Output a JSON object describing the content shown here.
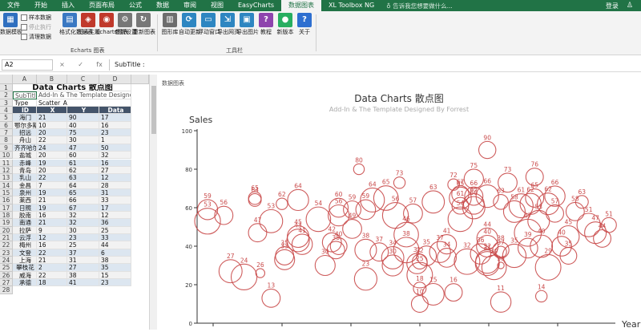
{
  "ribbon_tabs": [
    "文件",
    "开始",
    "插入",
    "页面布局",
    "公式",
    "数据",
    "审阅",
    "视图",
    "EasyCharts",
    "数据图表",
    "XL Toolbox NG"
  ],
  "active_tab": "数据图表",
  "tell_me": "告诉我您想要做什么...",
  "login": "登录",
  "share": "♙",
  "ribbon": {
    "left_buttons": [
      {
        "id": "data-template",
        "label": "数据模板",
        "color": "#2f6fbf",
        "glyph": "▦"
      }
    ],
    "small_buttons": [
      {
        "id": "sample-data",
        "label": "样本数据",
        "disabled": false
      },
      {
        "id": "stop-exec",
        "label": "停止执行",
        "disabled": true
      },
      {
        "id": "clear-data",
        "label": "清理数据",
        "disabled": false
      }
    ],
    "group1_buttons": [
      {
        "id": "format-data",
        "label": "格式化数据表",
        "color": "#3a78c2",
        "glyph": "▤"
      },
      {
        "id": "chart-theme",
        "label": "图表主题",
        "color": "#c0392b",
        "glyph": "◈"
      },
      {
        "id": "echarts-chart",
        "label": "Echarts图表",
        "color": "#c0392b",
        "glyph": "◉"
      },
      {
        "id": "param-settings",
        "label": "参数设置",
        "color": "#777777",
        "glyph": "⚙"
      },
      {
        "id": "redraw-chart",
        "label": "重新图表",
        "color": "#777777",
        "glyph": "↻"
      }
    ],
    "group1_label": "Echarts 图表",
    "group2_buttons": [
      {
        "id": "chart-library",
        "label": "图形库",
        "color": "#6d6d6d",
        "glyph": "▥"
      },
      {
        "id": "auto-update",
        "label": "自动更新",
        "color": "#2e86c1",
        "glyph": "⟳"
      },
      {
        "id": "float-window",
        "label": "浮动窗口",
        "color": "#2e86c1",
        "glyph": "▭"
      },
      {
        "id": "export-page",
        "label": "导出网页",
        "color": "#2e86c1",
        "glyph": "⇲"
      },
      {
        "id": "export-image",
        "label": "导出图片",
        "color": "#2e86c1",
        "glyph": "▣"
      },
      {
        "id": "tutorial",
        "label": "教程",
        "color": "#8e44ad",
        "glyph": "?"
      },
      {
        "id": "new-version",
        "label": "新版本",
        "color": "#27ae60",
        "glyph": "●"
      },
      {
        "id": "about",
        "label": "关于",
        "color": "#2e6fd0",
        "glyph": "?"
      }
    ],
    "group2_label": "工具栏"
  },
  "formula_bar": {
    "name_box": "A2",
    "fx_icons": [
      "×",
      "✓",
      "fx"
    ],
    "formula": "SubTitle :"
  },
  "grid": {
    "columns": [
      "A",
      "B",
      "C",
      "D"
    ],
    "row_numbers": [
      "1",
      "2",
      "3",
      "4",
      "5",
      "6",
      "7",
      "8",
      "9",
      "10",
      "11",
      "12",
      "13",
      "14",
      "15",
      "16",
      "17",
      "18",
      "19",
      "20",
      "21",
      "22",
      "23",
      "24",
      "25",
      "26",
      "27",
      "28"
    ],
    "title": "Data Charts 散点图",
    "subtitle_label": "SubTitle",
    "subtitle_value": "Add-In & The Template Designed By Forrest",
    "type_label": "Type",
    "type_value": "Scatter_A",
    "headers": [
      "ID",
      "X",
      "Y",
      "Data"
    ],
    "rows": [
      [
        "海门",
        "21",
        "90",
        "17"
      ],
      [
        "鄂尔多斯",
        "10",
        "40",
        "16"
      ],
      [
        "招远",
        "20",
        "75",
        "23"
      ],
      [
        "舟山",
        "22",
        "30",
        "1"
      ],
      [
        "齐齐哈尔",
        "24",
        "47",
        "50"
      ],
      [
        "盐城",
        "20",
        "60",
        "32"
      ],
      [
        "赤峰",
        "19",
        "61",
        "16"
      ],
      [
        "青岛",
        "20",
        "62",
        "27"
      ],
      [
        "乳山",
        "22",
        "63",
        "12"
      ],
      [
        "金昌",
        "7",
        "64",
        "28"
      ],
      [
        "泉州",
        "19",
        "65",
        "31"
      ],
      [
        "莱西",
        "21",
        "66",
        "33"
      ],
      [
        "日照",
        "19",
        "67",
        "17"
      ],
      [
        "胶南",
        "16",
        "32",
        "12"
      ],
      [
        "南通",
        "21",
        "32",
        "36"
      ],
      [
        "拉萨",
        "9",
        "30",
        "25"
      ],
      [
        "云浮",
        "12",
        "23",
        "33"
      ],
      [
        "梅州",
        "16",
        "25",
        "44"
      ],
      [
        "文登",
        "22",
        "37",
        "6"
      ],
      [
        "上海",
        "21",
        "31",
        "38"
      ],
      [
        "攀枝花",
        "2",
        "27",
        "35"
      ],
      [
        "威海",
        "22",
        "38",
        "15"
      ],
      [
        "承德",
        "18",
        "41",
        "23"
      ]
    ]
  },
  "chart_tag": "数据图表",
  "chart_data": {
    "type": "scatter",
    "title": "Data Charts 散点图",
    "subtitle": "Add-In & The Template Designed By Forrest",
    "xlabel": "Year",
    "ylabel": "Sales",
    "ylim": [
      0,
      100
    ],
    "yticks": [
      0,
      20,
      40,
      60,
      80,
      100
    ],
    "xlim": [
      0,
      30
    ],
    "color": "#c94a4a",
    "grid": false,
    "points": [
      {
        "x": 21,
        "y": 90,
        "size": 17
      },
      {
        "x": 10,
        "y": 40,
        "size": 16
      },
      {
        "x": 20,
        "y": 75,
        "size": 23
      },
      {
        "x": 22,
        "y": 30,
        "size": 1
      },
      {
        "x": 24,
        "y": 47,
        "size": 50
      },
      {
        "x": 20,
        "y": 60,
        "size": 32
      },
      {
        "x": 19,
        "y": 61,
        "size": 16
      },
      {
        "x": 20,
        "y": 62,
        "size": 27
      },
      {
        "x": 22,
        "y": 63,
        "size": 12
      },
      {
        "x": 7,
        "y": 64,
        "size": 28
      },
      {
        "x": 19,
        "y": 65,
        "size": 31
      },
      {
        "x": 21,
        "y": 66,
        "size": 33
      },
      {
        "x": 19,
        "y": 67,
        "size": 17
      },
      {
        "x": 16,
        "y": 32,
        "size": 12
      },
      {
        "x": 21,
        "y": 32,
        "size": 36
      },
      {
        "x": 9,
        "y": 30,
        "size": 25
      },
      {
        "x": 12,
        "y": 23,
        "size": 33
      },
      {
        "x": 16,
        "y": 25,
        "size": 44
      },
      {
        "x": 22,
        "y": 37,
        "size": 6
      },
      {
        "x": 21,
        "y": 31,
        "size": 38
      },
      {
        "x": 2,
        "y": 27,
        "size": 35
      },
      {
        "x": 22,
        "y": 38,
        "size": 15
      },
      {
        "x": 18,
        "y": 41,
        "size": 23
      },
      {
        "x": 0.3,
        "y": 59,
        "size": 25
      },
      {
        "x": 0.3,
        "y": 53,
        "size": 45
      },
      {
        "x": 1.5,
        "y": 56,
        "size": 20
      },
      {
        "x": 3,
        "y": 24,
        "size": 45
      },
      {
        "x": 3.8,
        "y": 65,
        "size": 8
      },
      {
        "x": 3.8,
        "y": 64,
        "size": 8
      },
      {
        "x": 4,
        "y": 47,
        "size": 20
      },
      {
        "x": 4.2,
        "y": 26,
        "size": 3
      },
      {
        "x": 5,
        "y": 53,
        "size": 35
      },
      {
        "x": 5,
        "y": 13,
        "size": 20
      },
      {
        "x": 5.8,
        "y": 62,
        "size": 6
      },
      {
        "x": 6,
        "y": 33,
        "size": 25
      },
      {
        "x": 6,
        "y": 35,
        "size": 20
      },
      {
        "x": 7,
        "y": 43,
        "size": 33
      },
      {
        "x": 7,
        "y": 45,
        "size": 30
      },
      {
        "x": 7.3,
        "y": 41,
        "size": 26
      },
      {
        "x": 8.5,
        "y": 54,
        "size": 40
      },
      {
        "x": 9.5,
        "y": 42,
        "size": 22
      },
      {
        "x": 9.8,
        "y": 38,
        "size": 18
      },
      {
        "x": 10,
        "y": 60,
        "size": 22
      },
      {
        "x": 10,
        "y": 56,
        "size": 28
      },
      {
        "x": 11,
        "y": 59,
        "size": 18
      },
      {
        "x": 11,
        "y": 49,
        "size": 22
      },
      {
        "x": 11.5,
        "y": 80,
        "size": 5
      },
      {
        "x": 12,
        "y": 38,
        "size": 30
      },
      {
        "x": 12,
        "y": 59,
        "size": 24
      },
      {
        "x": 12.5,
        "y": 64,
        "size": 38
      },
      {
        "x": 13,
        "y": 37,
        "size": 20
      },
      {
        "x": 13.5,
        "y": 65,
        "size": 40
      },
      {
        "x": 14,
        "y": 30,
        "size": 28
      },
      {
        "x": 14,
        "y": 34,
        "size": 32
      },
      {
        "x": 14.2,
        "y": 56,
        "size": 45
      },
      {
        "x": 14.5,
        "y": 73,
        "size": 6
      },
      {
        "x": 15,
        "y": 46,
        "size": 40
      },
      {
        "x": 15,
        "y": 38,
        "size": 44
      },
      {
        "x": 15.5,
        "y": 57,
        "size": 22
      },
      {
        "x": 15.8,
        "y": 31,
        "size": 26
      },
      {
        "x": 16,
        "y": 18,
        "size": 8
      },
      {
        "x": 16,
        "y": 10,
        "size": 16
      },
      {
        "x": 16.5,
        "y": 35,
        "size": 24
      },
      {
        "x": 17,
        "y": 63,
        "size": 32
      },
      {
        "x": 17,
        "y": 15,
        "size": 30
      },
      {
        "x": 17.5,
        "y": 37,
        "size": 28
      },
      {
        "x": 18,
        "y": 34,
        "size": 22
      },
      {
        "x": 18.5,
        "y": 72,
        "size": 6
      },
      {
        "x": 18.5,
        "y": 16,
        "size": 18
      },
      {
        "x": 19,
        "y": 54,
        "size": 40
      },
      {
        "x": 19.5,
        "y": 32,
        "size": 44
      },
      {
        "x": 20,
        "y": 66,
        "size": 20
      },
      {
        "x": 20.5,
        "y": 36,
        "size": 26
      },
      {
        "x": 21,
        "y": 40,
        "size": 30
      },
      {
        "x": 21,
        "y": 44,
        "size": 28
      },
      {
        "x": 21.5,
        "y": 29,
        "size": 40
      },
      {
        "x": 22,
        "y": 11,
        "size": 26
      },
      {
        "x": 22.5,
        "y": 73,
        "size": 22
      },
      {
        "x": 23,
        "y": 58,
        "size": 30
      },
      {
        "x": 23,
        "y": 35,
        "size": 36
      },
      {
        "x": 23.5,
        "y": 61,
        "size": 38
      },
      {
        "x": 24,
        "y": 39,
        "size": 24
      },
      {
        "x": 24.2,
        "y": 62,
        "size": 28
      },
      {
        "x": 24.5,
        "y": 65,
        "size": 20
      },
      {
        "x": 24.5,
        "y": 76,
        "size": 18
      },
      {
        "x": 24.8,
        "y": 53,
        "size": 30
      },
      {
        "x": 25,
        "y": 40,
        "size": 32
      },
      {
        "x": 25,
        "y": 14,
        "size": 6
      },
      {
        "x": 25.5,
        "y": 62,
        "size": 30
      },
      {
        "x": 25.5,
        "y": 29,
        "size": 44
      },
      {
        "x": 26,
        "y": 66,
        "size": 26
      },
      {
        "x": 26,
        "y": 57,
        "size": 18
      },
      {
        "x": 26.5,
        "y": 40,
        "size": 24
      },
      {
        "x": 27,
        "y": 35,
        "size": 16
      },
      {
        "x": 27,
        "y": 45,
        "size": 30
      },
      {
        "x": 27.5,
        "y": 58,
        "size": 20
      },
      {
        "x": 28,
        "y": 63,
        "size": 8
      },
      {
        "x": 28.5,
        "y": 51,
        "size": 36
      },
      {
        "x": 29,
        "y": 47,
        "size": 30
      },
      {
        "x": 29.5,
        "y": 44,
        "size": 18
      },
      {
        "x": 30,
        "y": 51,
        "size": 12
      }
    ]
  }
}
